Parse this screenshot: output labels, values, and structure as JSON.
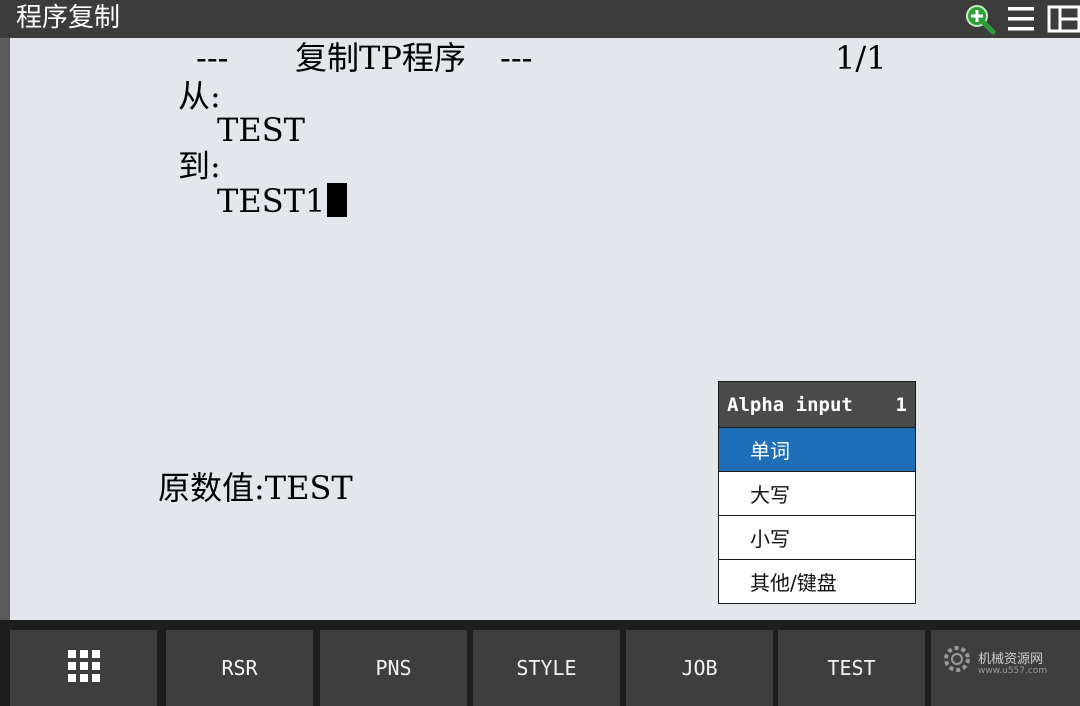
{
  "window": {
    "title": "程序复制",
    "icons": [
      "zoom-in-icon",
      "menu-icon",
      "layout-icon"
    ]
  },
  "screen": {
    "header_left": "---",
    "header_title": "复制TP程序",
    "header_right": "---",
    "page": "1/1",
    "from_label": "从:",
    "from_value": "TEST",
    "to_label": "到:",
    "to_value": "TEST1",
    "original_label": "原数值:",
    "original_value": "TEST"
  },
  "popup": {
    "title": "Alpha input",
    "number": "1",
    "items": [
      "单词",
      "大写",
      "小写",
      "其他/键盘"
    ],
    "selected_index": 0,
    "colors": {
      "selected": "#1f6fb8",
      "header": "#4a4a4a"
    }
  },
  "function_keys": {
    "menu_icon": "grid-icon",
    "keys": [
      "RSR",
      "PNS",
      "STYLE",
      "JOB",
      "TEST"
    ]
  },
  "watermark": {
    "name": "机械资源网",
    "url": "www.u557.com"
  }
}
